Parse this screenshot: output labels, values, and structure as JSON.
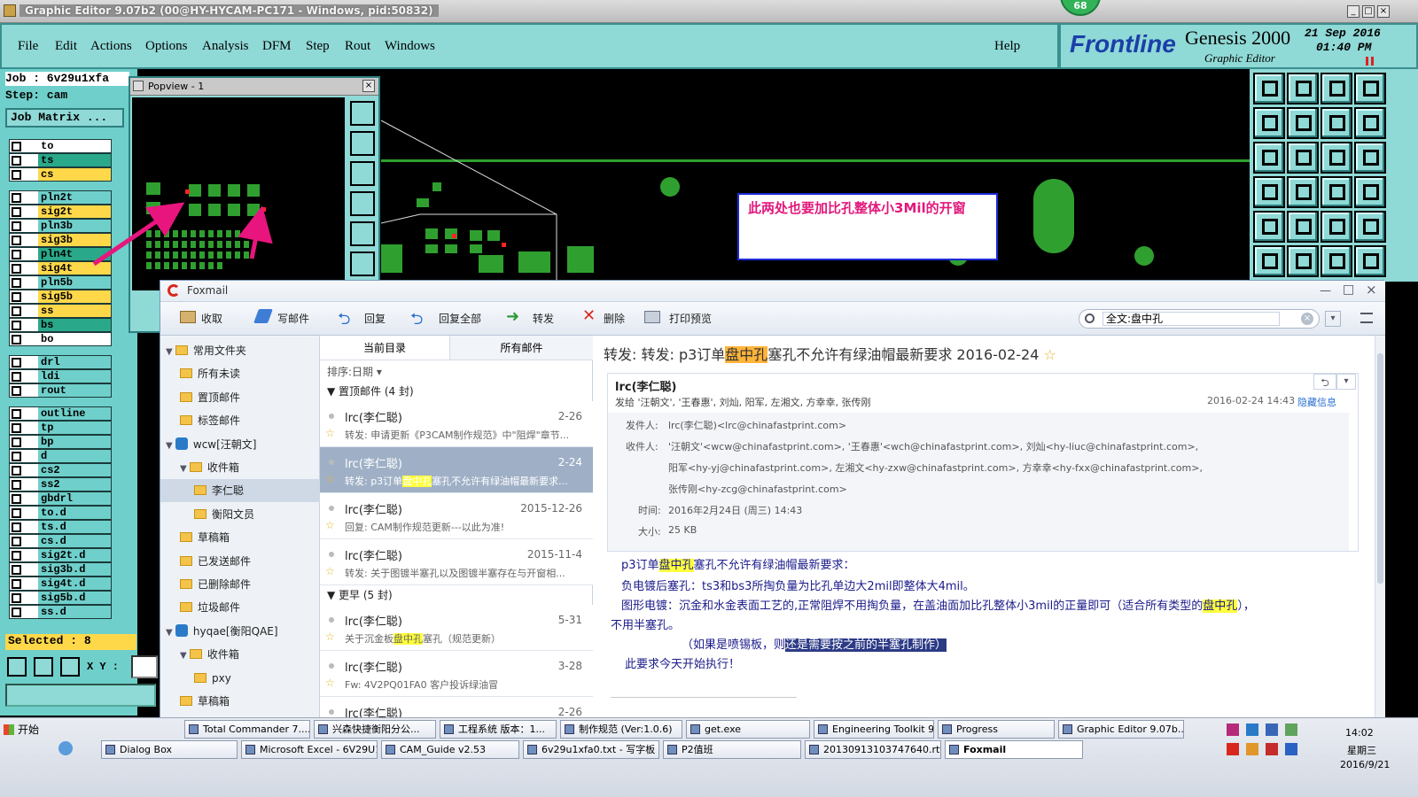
{
  "window": {
    "title": "Graphic Editor 9.07b2 (00@HY-HYCAM-PC171 - Windows, pid:50832)",
    "badge": "68"
  },
  "menu": {
    "file": "File",
    "edit": "Edit",
    "actions": "Actions",
    "options": "Options",
    "analysis": "Analysis",
    "dfm": "DFM",
    "step": "Step",
    "rout": "Rout",
    "windows": "Windows",
    "help": "Help"
  },
  "brand": {
    "logo": "Frontline",
    "product": "Genesis 2000",
    "subtitle": "Graphic Editor",
    "date": "21 Sep 2016",
    "time": "01:40 PM"
  },
  "job": {
    "job_label": "Job : 6v29u1xfa",
    "step_label": "Step: cam",
    "matrix": "Job Matrix ..."
  },
  "layers": [
    {
      "name": "to",
      "color": "#ffffff"
    },
    {
      "name": "ts",
      "color": "#2aa88a"
    },
    {
      "name": "cs",
      "color": "#ffd84a"
    },
    {
      "name": "pln2t",
      "color": "#6fcfca"
    },
    {
      "name": "sig2t",
      "color": "#ffd84a"
    },
    {
      "name": "pln3b",
      "color": "#6fcfca"
    },
    {
      "name": "sig3b",
      "color": "#ffd84a"
    },
    {
      "name": "pln4t",
      "color": "#2aa88a"
    },
    {
      "name": "sig4t",
      "color": "#ffd84a"
    },
    {
      "name": "pln5b",
      "color": "#6fcfca"
    },
    {
      "name": "sig5b",
      "color": "#ffd84a"
    },
    {
      "name": "ss",
      "color": "#ffd84a"
    },
    {
      "name": "bs",
      "color": "#2aa88a"
    },
    {
      "name": "bo",
      "color": "#ffffff"
    },
    {
      "name": "drl",
      "color": "#6fcfca"
    },
    {
      "name": "ldi",
      "color": "#6fcfca"
    },
    {
      "name": "rout",
      "color": "#6fcfca"
    },
    {
      "name": "outline",
      "color": "#6fcfca"
    },
    {
      "name": "tp",
      "color": "#6fcfca"
    },
    {
      "name": "bp",
      "color": "#6fcfca"
    },
    {
      "name": "d",
      "color": "#6fcfca"
    },
    {
      "name": "cs2",
      "color": "#6fcfca"
    },
    {
      "name": "ss2",
      "color": "#6fcfca"
    },
    {
      "name": "gbdrl",
      "color": "#6fcfca"
    },
    {
      "name": "to.d",
      "color": "#6fcfca"
    },
    {
      "name": "ts.d",
      "color": "#6fcfca"
    },
    {
      "name": "cs.d",
      "color": "#6fcfca"
    },
    {
      "name": "sig2t.d",
      "color": "#6fcfca"
    },
    {
      "name": "sig3b.d",
      "color": "#6fcfca"
    },
    {
      "name": "sig4t.d",
      "color": "#6fcfca"
    },
    {
      "name": "sig5b.d",
      "color": "#6fcfca"
    },
    {
      "name": "ss.d",
      "color": "#6fcfca"
    }
  ],
  "selected": "Selected : 8",
  "xy_label": "X Y :",
  "popview": {
    "title": "Popview - 1"
  },
  "annotation": "此两处也要加比孔整体小3Mil的开窗",
  "foxmail": {
    "title": "Foxmail",
    "toolbar": {
      "receive": "收取",
      "compose": "写邮件",
      "reply": "回复",
      "reply_all": "回复全部",
      "forward": "转发",
      "delete": "删除",
      "print": "打印预览"
    },
    "search": "全文:盘中孔",
    "folders": [
      {
        "label": "常用文件夹",
        "level": 0
      },
      {
        "label": "所有未读",
        "level": 1
      },
      {
        "label": "置顶邮件",
        "level": 1
      },
      {
        "label": "标签邮件",
        "level": 1
      },
      {
        "label": "wcw[汪朝文]",
        "level": 0
      },
      {
        "label": "收件箱",
        "level": 1
      },
      {
        "label": "李仁聪",
        "level": 2
      },
      {
        "label": "衡阳文员",
        "level": 2
      },
      {
        "label": "草稿箱",
        "level": 1
      },
      {
        "label": "已发送邮件",
        "level": 1
      },
      {
        "label": "已删除邮件",
        "level": 1
      },
      {
        "label": "垃圾邮件",
        "level": 1
      },
      {
        "label": "hyqae[衡阳QAE]",
        "level": 0
      },
      {
        "label": "收件箱",
        "level": 1
      },
      {
        "label": "pxy",
        "level": 2
      },
      {
        "label": "草稿箱",
        "level": 1
      }
    ],
    "tabs": {
      "current": "当前目录",
      "all": "所有邮件"
    },
    "sort": "排序:日期",
    "group_pinned": "置顶邮件 (4 封)",
    "group_earlier": "更早 (5 封)",
    "messages_pinned": [
      {
        "from": "lrc(李仁聪)",
        "date": "2-26",
        "subj": "转发: 申请更新《P3CAM制作规范》中\"阻焊\"章节..."
      },
      {
        "from": "lrc(李仁聪)",
        "date": "2-24",
        "subj_a": "转发: p3订单",
        "subj_hl": "盘中孔",
        "subj_b": "塞孔不允许有绿油帽最新要求..."
      },
      {
        "from": "lrc(李仁聪)",
        "date": "2015-12-26",
        "subj": "回复: CAM制作规范更新---以此为准!"
      },
      {
        "from": "lrc(李仁聪)",
        "date": "2015-11-4",
        "subj": "转发: 关于图镀半塞孔以及图镀半塞存在与开窗相..."
      }
    ],
    "messages_earlier": [
      {
        "from": "lrc(李仁聪)",
        "date": "5-31",
        "subj_a": "关于沉金板",
        "subj_hl": "盘中孔",
        "subj_b": "塞孔（规范更新）"
      },
      {
        "from": "lrc(李仁聪)",
        "date": "3-28",
        "subj": "Fw: 4V2PQ01FA0 客户投诉绿油冒"
      },
      {
        "from": "lrc(李仁聪)",
        "date": "2-26",
        "subj": ""
      }
    ],
    "reading": {
      "subject_a": "转发: 转发: p3订单",
      "subject_hl": "盘中孔",
      "subject_b": "塞孔不允许有绿油帽最新要求 2016-02-24",
      "sender": "lrc(李仁聪)",
      "sent_to": "发给 '汪朝文', '王春惠', 刘灿, 阳军, 左湘文, 方幸幸, 张传刚",
      "date_short": "2016-02-24 14:43",
      "hide_info": "隐藏信息",
      "from_label": "发件人:",
      "from_value": "lrc(李仁聪)<lrc@chinafastprint.com>",
      "to_label": "收件人:",
      "to_line1": "'汪朝文'<wcw@chinafastprint.com>, '王春惠'<wch@chinafastprint.com>, 刘灿<hy-liuc@chinafastprint.com>,",
      "to_line2": "阳军<hy-yj@chinafastprint.com>, 左湘文<hy-zxw@chinafastprint.com>, 方幸幸<hy-fxx@chinafastprint.com>,",
      "to_line3": "张传刚<hy-zcg@chinafastprint.com>",
      "time_label": "时间:",
      "time_value": "2016年2月24日 (周三) 14:43",
      "size_label": "大小:",
      "size_value": "25 KB",
      "body1_a": "p3订单",
      "body1_hl": "盘中孔",
      "body1_b": "塞孔不允许有绿油帽最新要求：",
      "body2": "负电镀后塞孔：ts3和bs3所掏负量为比孔单边大2mil即整体大4mil。",
      "body3_a": "图形电镀：沉金和水金表面工艺的,正常阻焊不用掏负量，在盖油面加比孔整体小3mil的正量即可（适合所有类型的",
      "body3_hl": "盘中孔",
      "body3_b": "），",
      "body4": "不用半塞孔。",
      "body5_a": "（如果是喷锡板，则",
      "body5_sel": "还是需要按之前的半塞孔制作）",
      "body6": "此要求今天开始执行！"
    }
  },
  "taskbar": {
    "start": "开始",
    "row1": [
      "Total Commander 7....",
      "兴森快捷衡阳分公...",
      "工程系统  版本：1...",
      "制作规范 (Ver:1.0.6)",
      "get.exe",
      "Engineering Toolkit 9...",
      "Progress",
      "Graphic Editor 9.07b..."
    ],
    "row2": [
      "Dialog Box",
      "Microsoft Excel - 6V29U1...",
      "CAM_Guide v2.53",
      "6v29u1xfa0.txt - 写字板",
      "P2值班",
      "20130913103747640.rtf...",
      "Foxmail"
    ],
    "clock": "14:02",
    "weekday": "星期三",
    "date": "2016/9/21"
  }
}
